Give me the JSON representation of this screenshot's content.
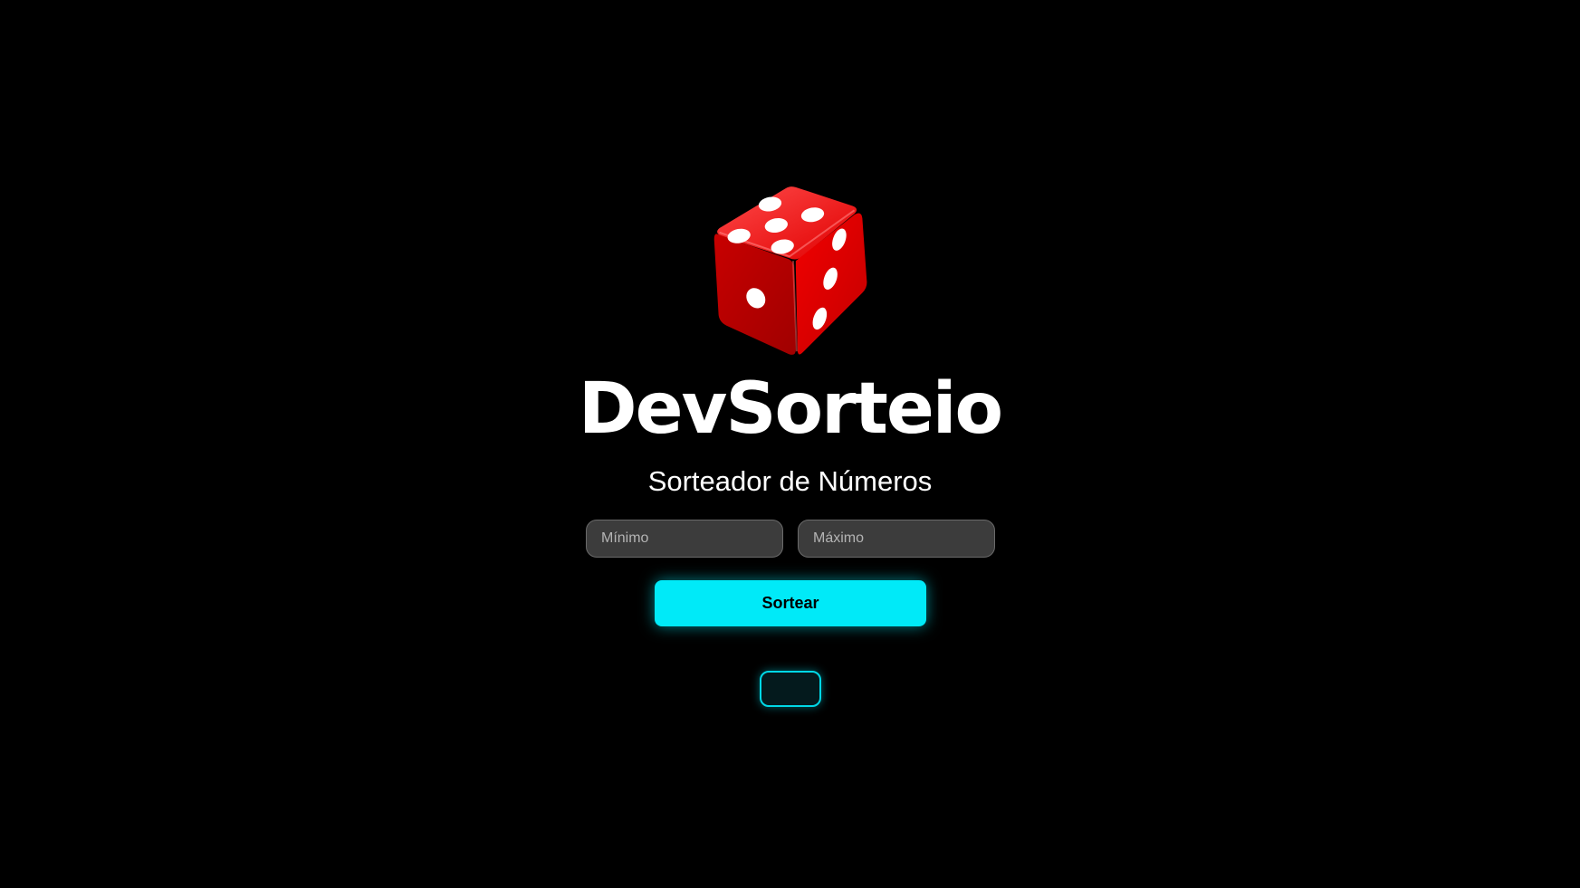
{
  "app": {
    "title": "DevSorteio",
    "subtitle": "Sorteador de Números"
  },
  "logo": {
    "icon": "dice-icon",
    "color": "#e00000"
  },
  "form": {
    "min_placeholder": "Mínimo",
    "min_value": "",
    "max_placeholder": "Máximo",
    "max_value": "",
    "button_label": "Sortear"
  },
  "result": {
    "value": ""
  },
  "colors": {
    "background": "#000000",
    "accent": "#00eaf8",
    "input_bg": "#3c3c3c"
  }
}
